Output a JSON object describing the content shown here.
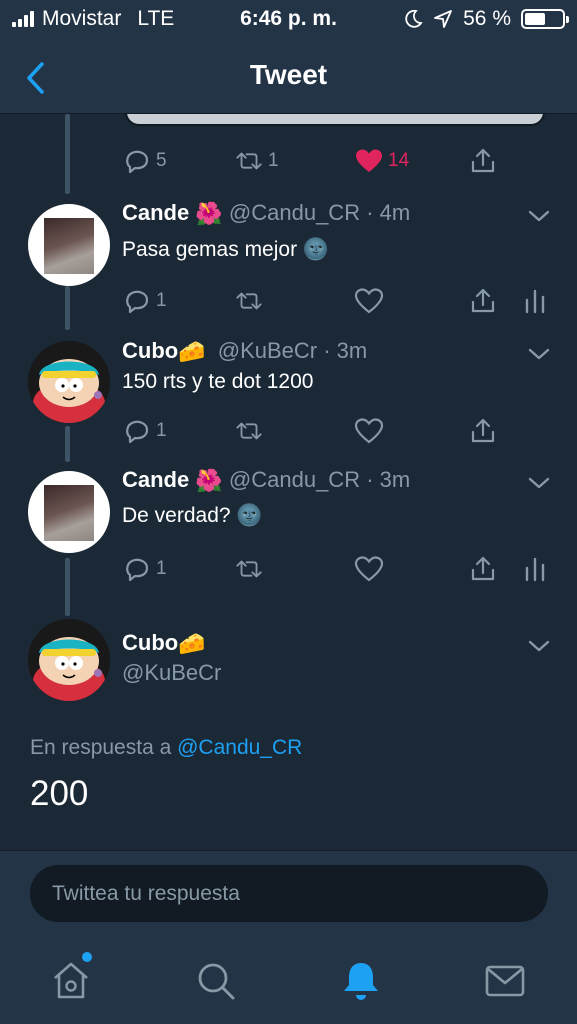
{
  "status_bar": {
    "carrier": "Movistar",
    "network": "LTE",
    "time": "6:46 p. m.",
    "battery_percent": "56 %",
    "battery_level": 0.56
  },
  "nav": {
    "title": "Tweet",
    "back_icon": "chevron-left-icon"
  },
  "top_actions": {
    "reply_count": "5",
    "retweet_count": "1",
    "like_count": "14"
  },
  "replies": [
    {
      "name": "Cande",
      "name_emoji": "🌺",
      "handle": "@Candu_CR",
      "time": "· 4m",
      "text": "Pasa gemas mejor",
      "text_emoji": "🌚",
      "reply_count": "1"
    },
    {
      "name": "Cubo",
      "name_emoji": "🧀",
      "handle": "@KuBeCr",
      "time": "· 3m",
      "text": "150 rts y te dot 1200",
      "reply_count": "1"
    },
    {
      "name": "Cande",
      "name_emoji": "🌺",
      "handle": "@Candu_CR",
      "time": "· 3m",
      "text": "De verdad?",
      "text_emoji": "🌚",
      "reply_count": "1"
    }
  ],
  "main_tweet": {
    "name": "Cubo",
    "name_emoji": "🧀",
    "handle": "@KuBeCr",
    "reply_to_label": "En respuesta a",
    "reply_to_handle": "@Candu_CR",
    "text": "200"
  },
  "reply_bar": {
    "placeholder": "Twittea tu respuesta"
  },
  "tab_bar": {
    "tabs": [
      "home-icon",
      "search-icon",
      "notifications-bell-icon",
      "messages-envelope-icon"
    ],
    "active_tab": "notifications-bell-icon"
  },
  "colors": {
    "background": "#1b2836",
    "bars": "#243447",
    "accent": "#1da1f2",
    "like": "#e0245e",
    "secondary_text": "#8899a6"
  }
}
